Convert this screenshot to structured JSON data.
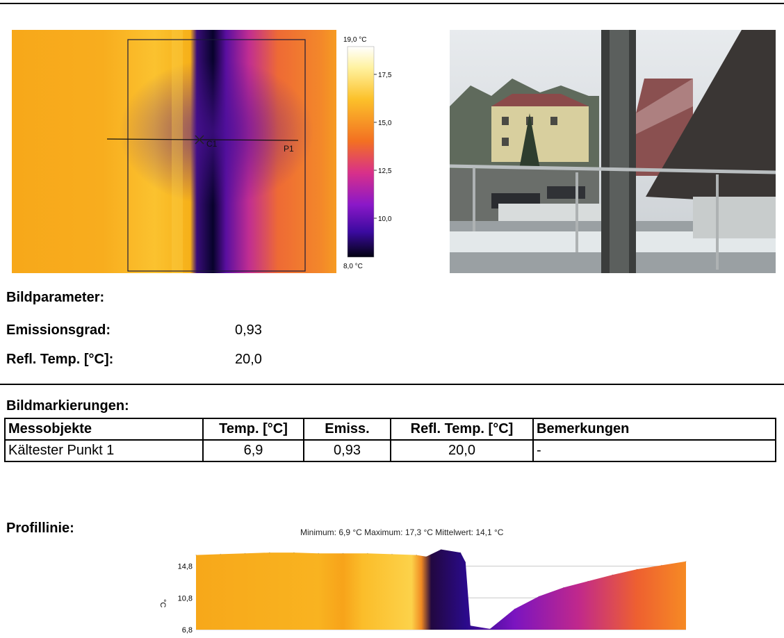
{
  "thermal": {
    "marker_label": "C1",
    "profile_label": "P1",
    "scale": {
      "max": "19,0 °C",
      "min": "8,0 °C",
      "ticks": [
        "17,5",
        "15,0",
        "12,5",
        "10,0"
      ]
    }
  },
  "params": {
    "heading": "Bildparameter:",
    "rows": [
      {
        "label": "Emissionsgrad:",
        "value": "0,93"
      },
      {
        "label": "Refl. Temp. [°C]:",
        "value": "20,0"
      }
    ]
  },
  "markings": {
    "heading": "Bildmarkierungen:",
    "columns": [
      "Messobjekte",
      "Temp. [°C]",
      "Emiss.",
      "Refl. Temp. [°C]",
      "Bemerkungen"
    ],
    "rows": [
      [
        "Kältester Punkt 1",
        "6,9",
        "0,93",
        "20,0",
        "-"
      ]
    ]
  },
  "profile": {
    "heading": "Profillinie:",
    "stats": "Minimum:  6,9  °C Maximum:  17,3  °C Mittelwert:  14,1  °C",
    "unit": "°C"
  },
  "chart_data": {
    "type": "area",
    "ylabel": "°C",
    "ylim": [
      6.8,
      17.3
    ],
    "yticks": [
      "14,8",
      "10,8",
      "6,8"
    ],
    "x": [
      0,
      5,
      10,
      15,
      20,
      25,
      30,
      35,
      40,
      45,
      47,
      50,
      54,
      55,
      56,
      60,
      65,
      70,
      75,
      80,
      85,
      90,
      95,
      100
    ],
    "values": [
      16.2,
      16.3,
      16.4,
      16.5,
      16.5,
      16.4,
      16.4,
      16.4,
      16.3,
      16.2,
      16.0,
      16.9,
      16.5,
      15.3,
      7.3,
      6.9,
      9.4,
      11.0,
      12.1,
      12.9,
      13.7,
      14.4,
      14.9,
      15.4
    ]
  }
}
